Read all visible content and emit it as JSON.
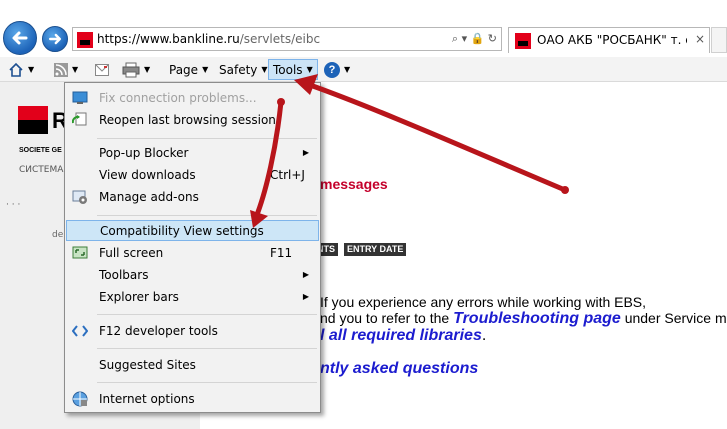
{
  "browser": {
    "url_host": "https://www.bankline.ru",
    "url_path": "/servlets/eibc",
    "tab_title": "ОАО АКБ \"РОСБАНК\" т. е-...",
    "address_icons": "⌕ ▾ 🔒 ↻",
    "tab_close": "×"
  },
  "commandbar": {
    "page_label": "Page",
    "safety_label": "Safety",
    "tools_label": "Tools",
    "help_label": "?"
  },
  "page": {
    "logo_letter": "R",
    "logo_subtitle": "SOCIETE GE",
    "logo_subtitle2": "СИСТЕМА",
    "side_dots": "· · ·",
    "side_text": "de",
    "heading": "messages",
    "table_headers": [
      "NTS",
      "ENTRY DATE"
    ],
    "line1": "If you experience any errors while working with EBS,",
    "line2_prefix": "nd you to refer to the",
    "line2_link": "Troubleshooting page",
    "line2_suffix": "under Service menu",
    "line3_link": "l all required libraries",
    "line3_suffix": ".",
    "line4_link": "ntly asked questions"
  },
  "menu": {
    "items": [
      {
        "label": "Fix connection problems...",
        "disabled": true
      },
      {
        "label": "Reopen last browsing session"
      },
      {
        "label": "Pop-up Blocker",
        "submenu": true
      },
      {
        "label": "View downloads",
        "shortcut": "Ctrl+J"
      },
      {
        "label": "Manage add-ons"
      },
      {
        "label": "Compatibility View settings",
        "highlighted": true
      },
      {
        "label": "Full screen",
        "shortcut": "F11"
      },
      {
        "label": "Toolbars",
        "submenu": true
      },
      {
        "label": "Explorer bars",
        "submenu": true
      },
      {
        "label": "F12 developer tools"
      },
      {
        "label": "Suggested Sites"
      },
      {
        "label": "Internet options"
      }
    ]
  },
  "colors": {
    "accent_red": "#c4002b",
    "link_blue": "#1c1ccf",
    "arrow_red": "#b8151b",
    "menu_highlight": "#cde6f7"
  }
}
